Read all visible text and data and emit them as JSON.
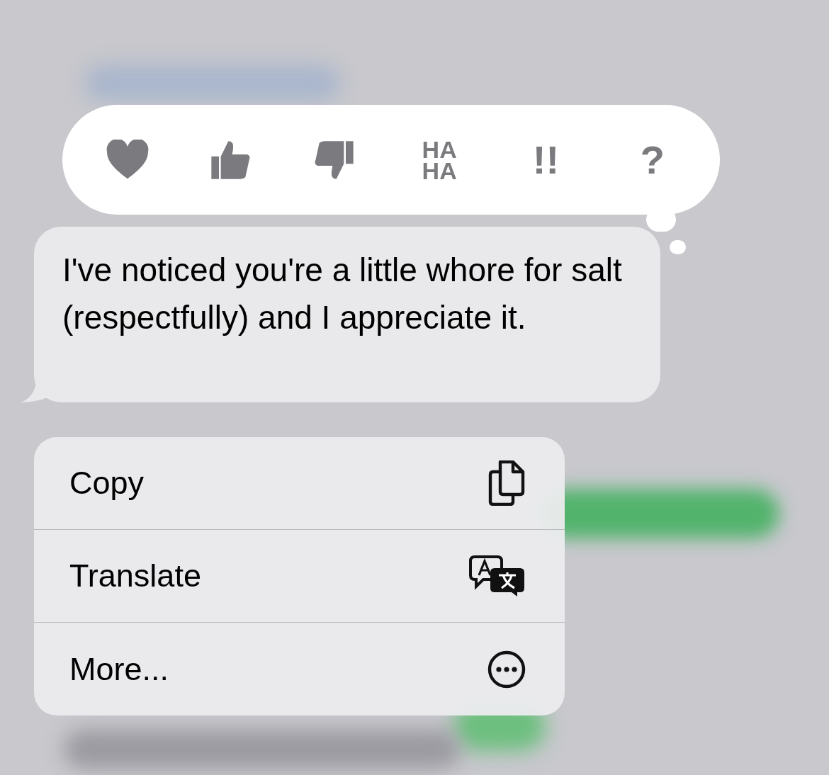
{
  "reactions": [
    {
      "kind": "heart"
    },
    {
      "kind": "thumbs-up"
    },
    {
      "kind": "thumbs-down"
    },
    {
      "kind": "text",
      "label": "HA HA"
    },
    {
      "kind": "text",
      "label": "!!"
    },
    {
      "kind": "text",
      "label": "?"
    }
  ],
  "message": {
    "text": "I've noticed you're a little whore for salt (respectfully) and I appreciate it."
  },
  "menu": [
    {
      "label": "Copy",
      "kind": "copy"
    },
    {
      "label": "Translate",
      "kind": "translate"
    },
    {
      "label": "More...",
      "kind": "more"
    }
  ]
}
